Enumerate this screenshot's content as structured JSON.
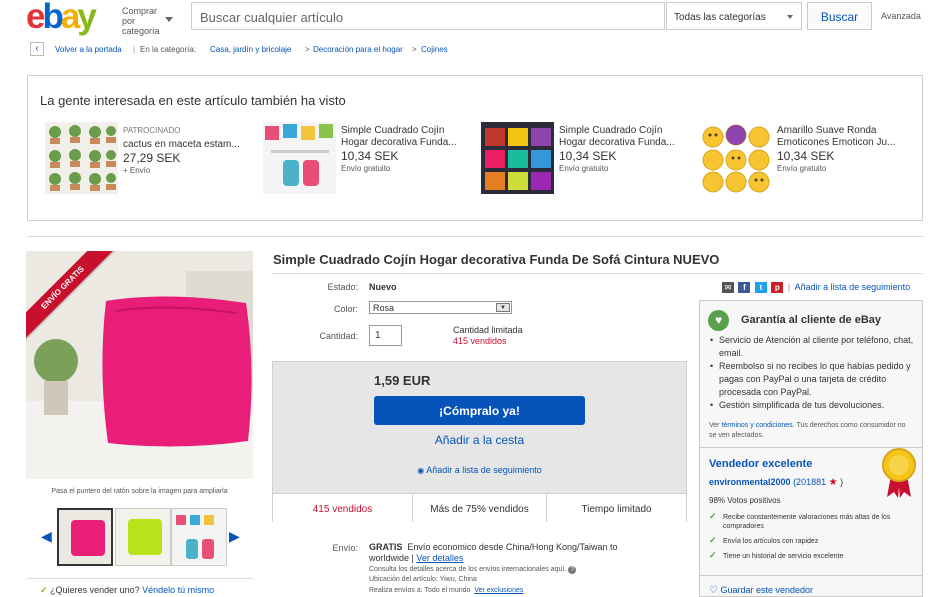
{
  "header": {
    "logo": [
      "e",
      "b",
      "a",
      "y"
    ],
    "logo_colors": [
      "#e53238",
      "#0064d2",
      "#f5af02",
      "#86b817"
    ],
    "shop_by_category": "Comprar por categoría",
    "search_placeholder": "Buscar cualquier artículo",
    "category_select": "Todas las categorías",
    "search_button": "Buscar",
    "advanced": "Avanzada"
  },
  "breadcrumb": {
    "back": "Volver a la portada",
    "in_category": "En la categoría:",
    "items": [
      "Casa, jardín y bricolaje",
      "Decoración para el hogar",
      "Cojines"
    ],
    "sep": ">"
  },
  "also_viewed": {
    "heading": "La gente interesada en este artículo también ha visto",
    "cards": [
      {
        "sponsored": "PATROCINADO",
        "title": "cactus en maceta estam...",
        "price": "27,29 SEK",
        "shipping": "+ Envío"
      },
      {
        "sponsored": "",
        "title": "Simple Cuadrado Cojín Hogar decorativa Funda...",
        "price": "10,34 SEK",
        "shipping": "Envío gratuito"
      },
      {
        "sponsored": "",
        "title": "Simple Cuadrado Cojín Hogar decorativa Funda...",
        "price": "10,34 SEK",
        "shipping": "Envío gratuito"
      },
      {
        "sponsored": "",
        "title": "Amarillo Suave Ronda Emoticones Emoticon Ju...",
        "price": "10,34 SEK",
        "shipping": "Envío gratuito"
      }
    ]
  },
  "gallery": {
    "ribbon": "ENVÍO GRATIS",
    "hint": "Pasa el puntero del ratón sobre la imagen para ampliarla"
  },
  "sell": {
    "question": "¿Quieres vender uno?",
    "link": "Véndelo tú mismo"
  },
  "product": {
    "title": "Simple Cuadrado Cojín Hogar decorativa Funda De Sofá Cintura NUEVO",
    "condition_label": "Estado:",
    "condition": "Nuevo",
    "color_label": "Color:",
    "color": "Rosa",
    "qty_label": "Cantidad:",
    "qty": "1",
    "limited": "Cantidad limitada",
    "sold_small": "415 vendidos",
    "price": "1,59 EUR",
    "buy_now": "¡Cómpralo ya!",
    "add_cart": "Añadir a la cesta",
    "watch": "Añadir a lista de seguimiento",
    "stats": [
      "415 vendidos",
      "Más de 75% vendidos",
      "Tiempo limitado"
    ],
    "shipping_label": "Envío:",
    "shipping_free": "GRATIS",
    "shipping_text": "Envío economico desde China/Hong Kong/Taiwan to worldwide |",
    "see_details": "Ver detalles",
    "intl_note": "Consulta los detalles acerca de los envíos internacionales aquí.",
    "location": "Ubicación del artículo: Yiwu, China",
    "ships_to": "Realiza envíos a:  Todo el mundo",
    "exclusions": "Ver exclusiones"
  },
  "share": {
    "watch_link": "Añadir a lista de seguimiento"
  },
  "guarantee": {
    "title": "Garantía al cliente de eBay",
    "bullets": [
      "Servicio de Atención al cliente por teléfono, chat, email.",
      "Reembolso si no recibes lo que habías pedido y pagas con PayPal o una tarjeta de crédito procesada con PayPal.",
      "Gestión simplificada de tus devoluciones."
    ],
    "terms_pre": "Ver",
    "terms_link": "términos y condiciones",
    "terms_post": ". Tus derechos como consumidor no se ven afectados."
  },
  "seller": {
    "badge": "Vendedor excelente",
    "name": "environmental2000",
    "score": "(201881",
    "score_close": ")",
    "positive": "98% Votos positivos",
    "checks": [
      "Recibe constantemente valoraciones más altas de los compradores",
      "Envía los artículos con rapidez",
      "Tiene un historial de servicio excelente"
    ],
    "save": "Guardar este vendedor"
  }
}
